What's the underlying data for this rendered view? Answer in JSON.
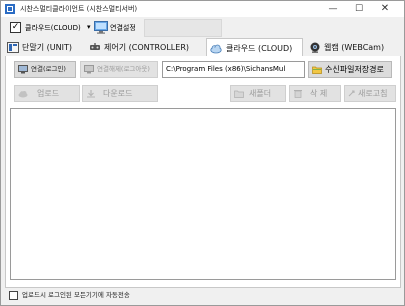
{
  "window": {
    "title": "시찬스멀티클라이언트 (시찬스멀티서버)",
    "minimize_glyph": "—",
    "maximize_glyph": "☐",
    "close_glyph": "✕"
  },
  "toolbar": {
    "cloud_checkbox_glyph": "✓",
    "cloud_label": "클라우드(CLOUD)",
    "dropdown_glyph": "▾",
    "connection_settings_label": "연결설정"
  },
  "tabs": [
    {
      "label": "단말기 (UNIT)",
      "icon": "unit-icon"
    },
    {
      "label": "제어기 (CONTROLLER)",
      "icon": "controller-icon"
    },
    {
      "label": "클라우드 (CLOUD)",
      "icon": "cloud-icon",
      "active": true
    },
    {
      "label": "웹캠 (WEBCam)",
      "icon": "webcam-icon"
    }
  ],
  "cloud_panel": {
    "connect_label": "연결(로그인)",
    "disconnect_label": "연결해제(로그아웃)",
    "receive_path_value": "C:\\Program Files (x86)\\SichansMul",
    "save_path_label": "수신파일저장경로",
    "upload_label": "업로드",
    "download_label": "다운로드",
    "new_folder_label": "새폴더",
    "delete_label": "삭 제",
    "refresh_label": "새로고침"
  },
  "status": {
    "auto_send_label": "업로드시 로그인된 모든기기에 자동전송"
  },
  "colors": {
    "window_bg": "#f0f0f0",
    "panel_bg": "#ffffff",
    "disabled_text": "#9a9a9a",
    "folder_yellow": "#f2c744"
  }
}
